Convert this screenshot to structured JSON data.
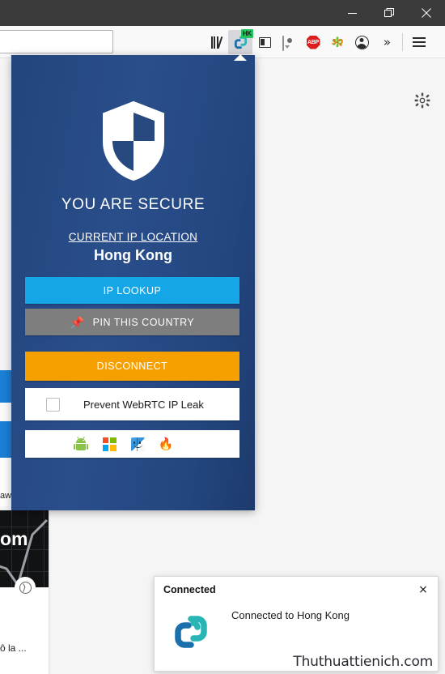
{
  "window": {
    "controls": {
      "minimize": "minimize-button",
      "restore": "restore-button",
      "close": "close-button"
    }
  },
  "toolbar": {
    "url_value": "",
    "url_placeholder": "",
    "icons": [
      {
        "name": "library-icon",
        "label": "Library"
      },
      {
        "name": "vpn-extension-icon",
        "label": "VPN",
        "badge": "HK"
      },
      {
        "name": "reader-view-icon",
        "label": "Reader View"
      },
      {
        "name": "speech-bubble-icon",
        "label": "Messenger"
      },
      {
        "name": "abp-icon",
        "label": "ABP"
      },
      {
        "name": "sq-icon",
        "label": "SQ"
      },
      {
        "name": "account-icon",
        "label": "Account"
      },
      {
        "name": "overflow-chevrons-icon",
        "label": "»"
      },
      {
        "name": "hamburger-menu-icon",
        "label": "Menu"
      }
    ]
  },
  "page": {
    "gear_label": "gear-icon",
    "left_text": "aw",
    "card": {
      "thumb_text": "om",
      "title": "ô la ..."
    }
  },
  "vpn_panel": {
    "shield_icon": "shield-icon",
    "status_title": "YOU ARE SECURE",
    "ip_location_label": "CURRENT IP LOCATION",
    "ip_location_value": "Hong Kong",
    "buttons": {
      "ip_lookup": "IP LOOKUP",
      "pin_country": "PIN THIS COUNTRY",
      "pin_emoji": "📌",
      "disconnect": "DISCONNECT"
    },
    "webrtc": {
      "label": "Prevent WebRTC IP Leak",
      "checked": false
    },
    "platforms": [
      {
        "name": "android-icon",
        "label": "Android"
      },
      {
        "name": "windows-icon",
        "label": "Windows"
      },
      {
        "name": "macos-finder-icon",
        "label": "macOS"
      },
      {
        "name": "flame-icon",
        "label": "🔥"
      }
    ],
    "colors": {
      "panel_bg_start": "#22457e",
      "panel_bg_end": "#1d3a6c",
      "lookup": "#14a6e6",
      "pin": "#7e7e7e",
      "disconnect": "#f6a000"
    }
  },
  "toast": {
    "title": "Connected",
    "message": "Connected to Hong Kong",
    "close_label": "×",
    "logo_name": "vpn-logo-icon"
  },
  "watermark": "Thuthuattienich.com"
}
